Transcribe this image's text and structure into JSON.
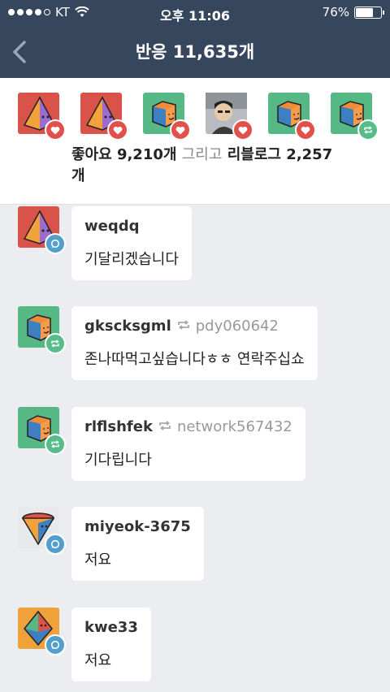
{
  "status": {
    "carrier": "KT",
    "time": "오후 11:06",
    "battery": "76%",
    "battery_level": 0.76
  },
  "nav": {
    "title": "반응 11,635개"
  },
  "summary": {
    "avatars": [
      {
        "icon": "pyramid-avatar",
        "badge": "heart"
      },
      {
        "icon": "pyramid-avatar",
        "badge": "heart"
      },
      {
        "icon": "cube-avatar",
        "badge": "heart"
      },
      {
        "icon": "photo-avatar",
        "badge": "heart"
      },
      {
        "icon": "cube-avatar",
        "badge": "heart"
      },
      {
        "icon": "cube-avatar",
        "badge": "reblog"
      }
    ],
    "likes": "좋아요 9,210개",
    "and": "그리고",
    "reblogs": "리블로그 2,257",
    "reblogs_suffix": "개"
  },
  "notes": [
    {
      "user": "weqdq",
      "source": "",
      "text": "기달리겠습니다",
      "icon": "pyramid-avatar",
      "badge": "comment"
    },
    {
      "user": "gkscksgml",
      "source": "pdy060642",
      "text": "존나따먹고싶습니다ㅎㅎ 연락주십쇼",
      "icon": "cube-avatar",
      "badge": "reblog"
    },
    {
      "user": "rlflshfek",
      "source": "network567432",
      "text": "기다립니다",
      "icon": "cube-avatar",
      "badge": "reblog"
    },
    {
      "user": "miyeok-3675",
      "source": "",
      "text": "저요",
      "icon": "cone-avatar",
      "badge": "comment"
    },
    {
      "user": "kwe33",
      "source": "",
      "text": "저요",
      "icon": "octahedron-avatar",
      "badge": "comment"
    }
  ]
}
